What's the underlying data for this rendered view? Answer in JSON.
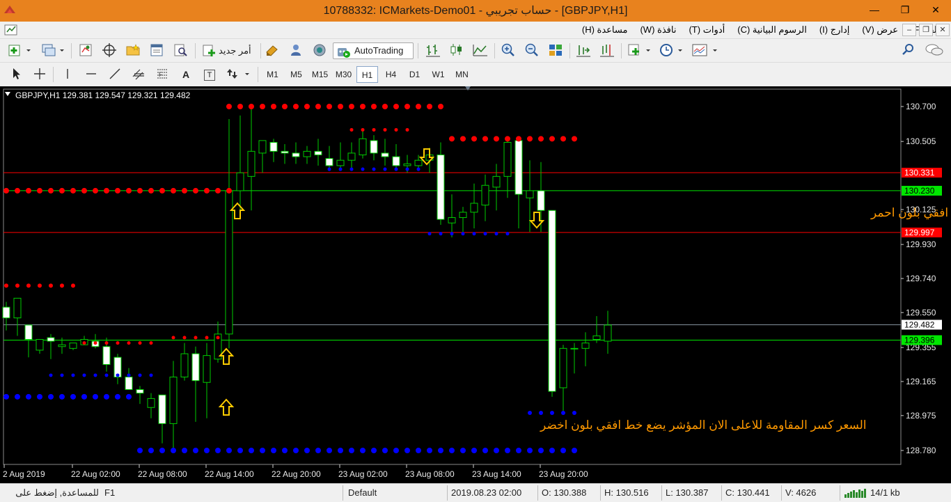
{
  "window": {
    "title": "10788332: ICMarkets-Demo01 - حساب تجريبي - [GBPJPY,H1]"
  },
  "menu": [
    "ملف (F)",
    "عرض (V)",
    "إدارج (I)",
    "الرسوم البيانية (C)",
    "أدوات (T)",
    "نافذة (W)",
    "مساعدة (H)"
  ],
  "toolbar": {
    "new_order_label": "أمر جديد",
    "autotrading_label": "AutoTrading"
  },
  "drawing_tools": {
    "text_tool": "A",
    "text_label_tool": "T"
  },
  "timeframes": [
    "M1",
    "M5",
    "M15",
    "M30",
    "H1",
    "H4",
    "D1",
    "W1",
    "MN"
  ],
  "active_timeframe": "H1",
  "chart": {
    "info": "GBPJPY,H1  129.381 129.547 129.321 129.482",
    "annotation_top": "السعر كسر الدعم للاسفل الان المؤشر يضع خط افقي بلون احمر",
    "annotation_bottom": "السعر كسر المقاومة للاعلى الان المؤشر يضع خط افقي بلون اخضر",
    "price_labels": [
      "130.700",
      "130.505",
      "130.125",
      "129.930",
      "129.740",
      "129.550",
      "129.355",
      "129.165",
      "128.975",
      "128.780"
    ],
    "time_labels": [
      "2 Aug 2019",
      "22 Aug 02:00",
      "22 Aug 08:00",
      "22 Aug 14:00",
      "22 Aug 20:00",
      "23 Aug 02:00",
      "23 Aug 08:00",
      "23 Aug 14:00",
      "23 Aug 20:00"
    ],
    "level_tags": [
      {
        "value": "130.331",
        "color": "#ff0000",
        "text_color": "#ffffff",
        "line": "#ff0000"
      },
      {
        "value": "130.230",
        "color": "#00e600",
        "text_color": "#000000",
        "line": "#00e600"
      },
      {
        "value": "129.997",
        "color": "#ff0000",
        "text_color": "#ffffff",
        "line": "#ff0000"
      },
      {
        "value": "129.482",
        "color": "#ffffff",
        "text_color": "#000000",
        "line": "#8c9aa6"
      },
      {
        "value": "129.396",
        "color": "#00e600",
        "text_color": "#000000",
        "line": "#00e600"
      }
    ],
    "colors": {
      "background": "#000000",
      "bull": "#00cc00",
      "bear_body": "#ffffff",
      "support_dots": "#ff0000",
      "resistance_dots": "#0000ff",
      "annotation": "#ff9900",
      "arrow": "#ffcc00"
    }
  },
  "status": {
    "help": "للمساعدة, إضغط على",
    "help_key": "F1",
    "profile": "Default",
    "datetime": "2019.08.23 02:00",
    "open": "O: 130.388",
    "high": "H: 130.516",
    "low": "L: 130.387",
    "close": "C: 130.441",
    "volume": "V: 4626",
    "traffic": "14/1 kb"
  }
}
